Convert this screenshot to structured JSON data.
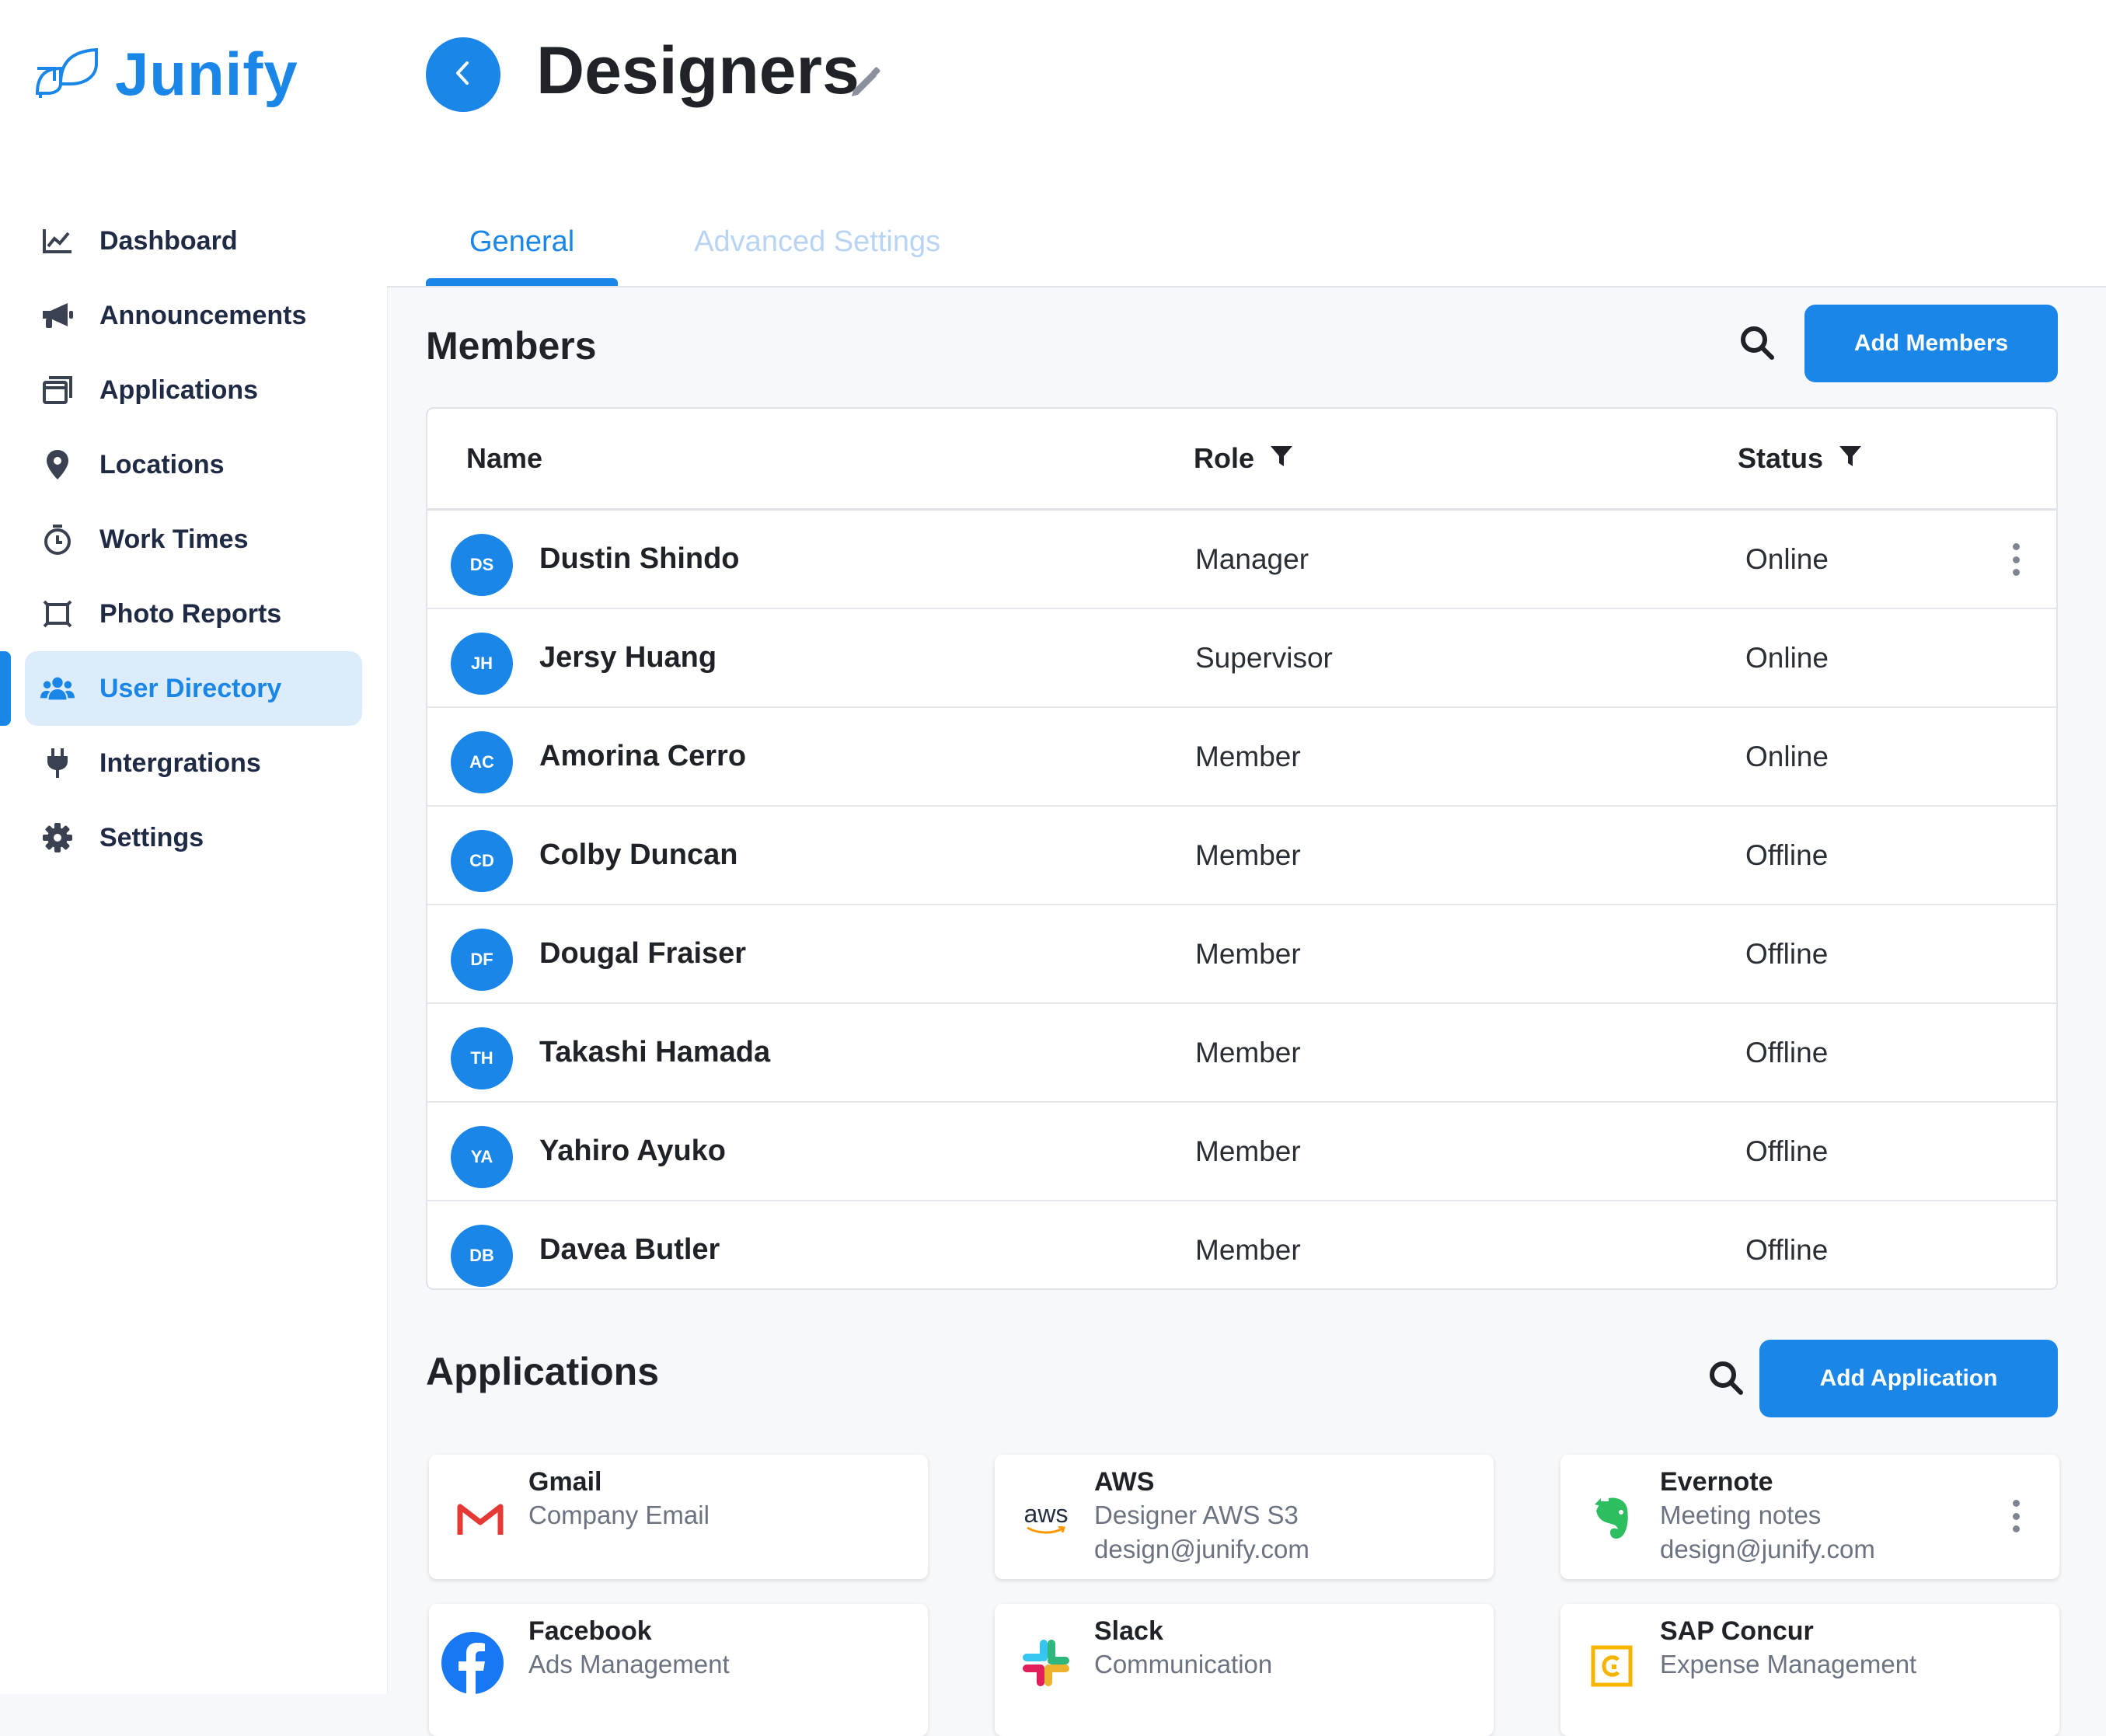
{
  "brand": {
    "name": "Junify",
    "color": "#1a86e8"
  },
  "sidebar": {
    "items": [
      {
        "label": "Dashboard",
        "icon": "chart-line-icon"
      },
      {
        "label": "Announcements",
        "icon": "megaphone-icon"
      },
      {
        "label": "Applications",
        "icon": "window-icon"
      },
      {
        "label": "Locations",
        "icon": "map-pin-icon"
      },
      {
        "label": "Work Times",
        "icon": "stopwatch-icon"
      },
      {
        "label": "Photo Reports",
        "icon": "photo-frame-icon"
      },
      {
        "label": "User Directory",
        "icon": "users-icon",
        "active": true
      },
      {
        "label": "Intergrations",
        "icon": "plug-icon"
      },
      {
        "label": "Settings",
        "icon": "gear-icon"
      }
    ]
  },
  "header": {
    "title": "Designers",
    "tabs": [
      {
        "label": "General",
        "active": true
      },
      {
        "label": "Advanced Settings",
        "active": false
      }
    ]
  },
  "members": {
    "title": "Members",
    "add_label": "Add  Members",
    "columns": {
      "name": "Name",
      "role": "Role",
      "status": "Status"
    },
    "rows": [
      {
        "initials": "DS",
        "name": "Dustin Shindo",
        "role": "Manager",
        "status": "Online"
      },
      {
        "initials": "JH",
        "name": "Jersy Huang",
        "role": "Supervisor",
        "status": "Online"
      },
      {
        "initials": "AC",
        "name": "Amorina Cerro",
        "role": "Member",
        "status": "Online"
      },
      {
        "initials": "CD",
        "name": "Colby Duncan",
        "role": "Member",
        "status": "Offline"
      },
      {
        "initials": "DF",
        "name": "Dougal Fraiser",
        "role": "Member",
        "status": "Offline"
      },
      {
        "initials": "TH",
        "name": "Takashi Hamada",
        "role": "Member",
        "status": "Offline"
      },
      {
        "initials": "YA",
        "name": "Yahiro Ayuko",
        "role": "Member",
        "status": "Offline"
      },
      {
        "initials": "DB",
        "name": "Davea Butler",
        "role": "Member",
        "status": "Offline"
      }
    ]
  },
  "applications": {
    "title": "Applications",
    "add_label": "Add Application",
    "cards": [
      {
        "name": "Gmail",
        "sub1": "Company Email",
        "sub2": "",
        "icon": "gmail-icon"
      },
      {
        "name": "AWS",
        "sub1": "Designer AWS S3",
        "sub2": "design@junify.com",
        "icon": "aws-icon",
        "logo_text": "aws"
      },
      {
        "name": "Evernote",
        "sub1": "Meeting notes",
        "sub2": "design@junify.com",
        "icon": "evernote-icon"
      },
      {
        "name": "Facebook",
        "sub1": "Ads Management",
        "sub2": "",
        "icon": "facebook-icon"
      },
      {
        "name": "Slack",
        "sub1": "Communication",
        "sub2": "",
        "icon": "slack-icon"
      },
      {
        "name": "SAP Concur",
        "sub1": "Expense Management",
        "sub2": "",
        "icon": "sap-concur-icon"
      }
    ]
  }
}
